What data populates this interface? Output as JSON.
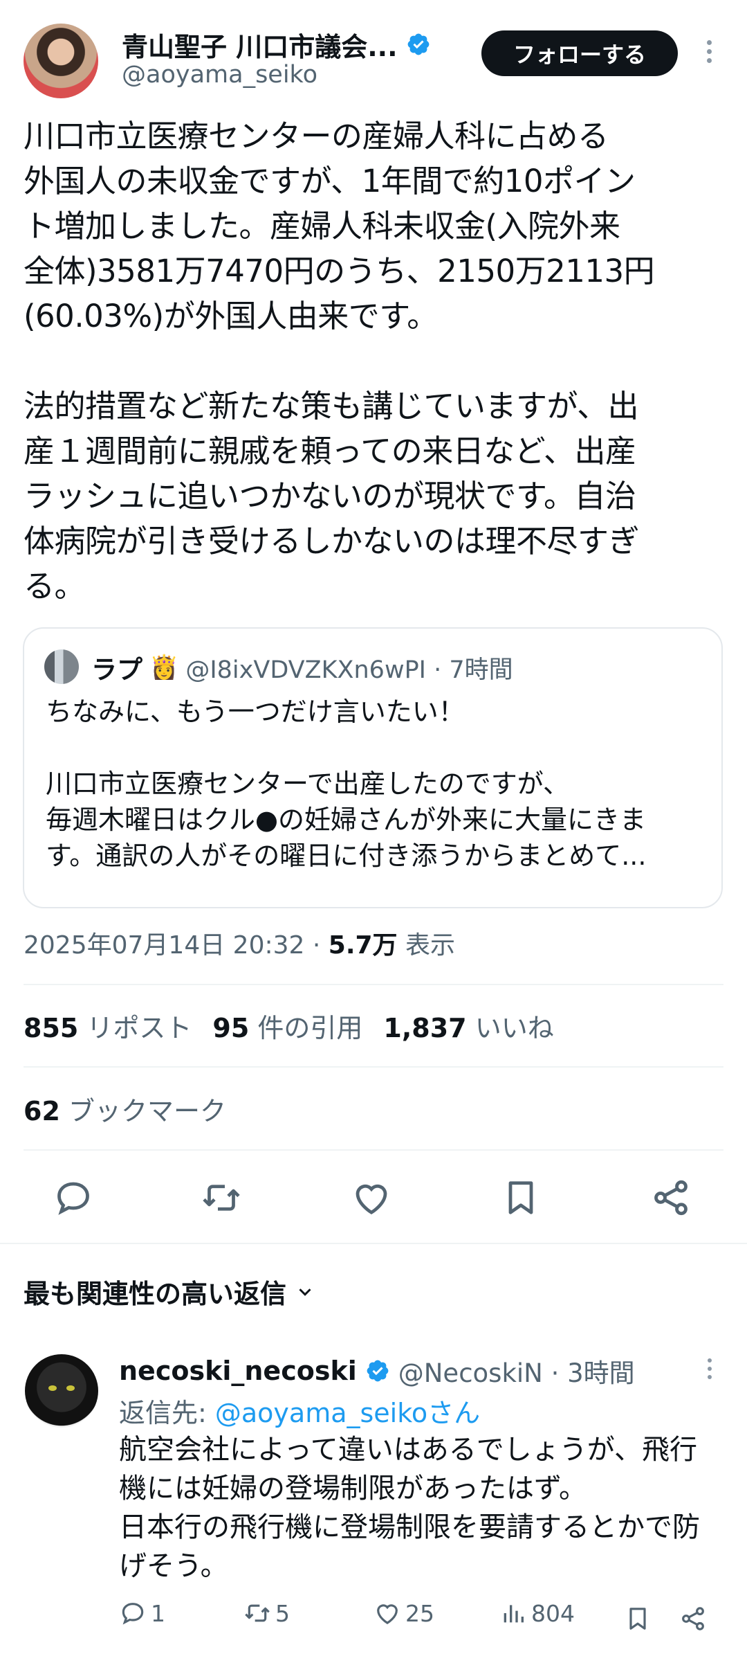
{
  "tweet": {
    "author_name": "青山聖子 川口市議会...",
    "author_handle": "@aoyama_seiko",
    "follow_label": "フォローする",
    "text": "川口市立医療センターの産婦人科に占める\n外国人の未収金ですが、1年間で約10ポイン\nト増加しました。産婦人科未収金(入院外来\n全体)3581万7470円のうち、2150万2113円\n(60.03%)が外国人由来です。\n\n法的措置など新たな策も講じていますが、出\n産１週間前に親戚を頼っての来日など、出産\nラッシュに追いつかないのが現状です。自治\n体病院が引き受けるしかないのは理不尽すぎ\nる。",
    "timestamp": "2025年07月14日 20:32 · ",
    "views_count": "5.7万",
    "views_label": " 表示"
  },
  "quote": {
    "name": "ラプ",
    "emoji": "👸",
    "meta": "@I8ixVDVZKXn6wPI · 7時間",
    "text": "ちなみに、もう一つだけ言いたい！\n\n川口市立医療センターで出産したのですが、\n毎週木曜日はクル●の妊婦さんが外来に大量にきま\nす。通訳の人がその曜日に付き添うからまとめて..."
  },
  "stats": {
    "reposts_count": "855",
    "reposts_label": " リポスト",
    "quotes_count": "95",
    "quotes_label": " 件の引用",
    "likes_count": "1,837",
    "likes_label": " いいね",
    "bookmarks_count": "62",
    "bookmarks_label": " ブックマーク"
  },
  "replies_sort_label": "最も関連性の高い返信",
  "reply": {
    "name": "necoski_necoski",
    "meta": "@NecoskiN · 3時間",
    "reply_to_prefix": "返信先: ",
    "reply_to_mention": "@aoyama_seikoさん",
    "text": "航空会社によって違いはあるでしょうが、飛行\n機には妊婦の登場制限があったはず。\n日本行の飛行機に登場制限を要請するとかで防\nげそう。",
    "reply_count": "1",
    "retweet_count": "5",
    "like_count": "25",
    "view_count": "804"
  },
  "icons": [
    "verified-badge-icon",
    "more-vertical-icon",
    "reply-icon",
    "retweet-icon",
    "like-icon",
    "bookmark-icon",
    "share-icon",
    "chevron-down-icon",
    "views-icon"
  ],
  "colors": {
    "accent": "#1d9bf0",
    "text": "#0f1419",
    "muted": "#536471",
    "button_bg": "#0f1419"
  }
}
